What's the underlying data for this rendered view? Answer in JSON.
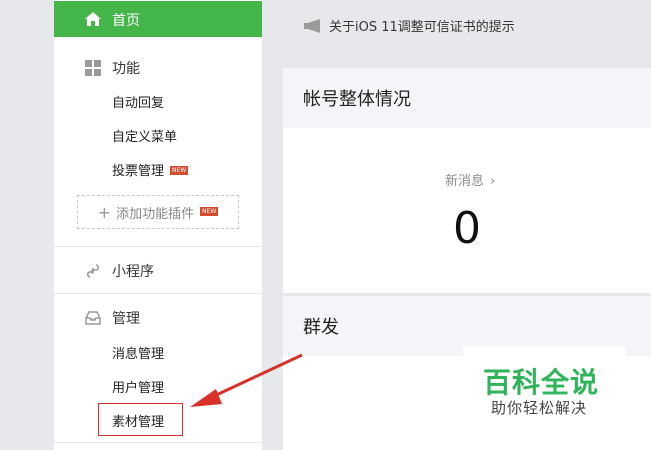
{
  "sidebar": {
    "home": {
      "label": "首页",
      "icon": "home-icon"
    },
    "features": {
      "label": "功能",
      "icon": "grid-icon",
      "items": [
        {
          "label": "自动回复"
        },
        {
          "label": "自定义菜单"
        },
        {
          "label": "投票管理",
          "badge": "NEW"
        }
      ],
      "add_plugin": {
        "label": "添加功能插件",
        "badge": "NEW"
      }
    },
    "mini_program": {
      "label": "小程序",
      "icon": "link-icon"
    },
    "manage": {
      "label": "管理",
      "icon": "inbox-icon",
      "items": [
        {
          "label": "消息管理"
        },
        {
          "label": "用户管理"
        },
        {
          "label": "素材管理"
        }
      ]
    }
  },
  "main": {
    "notice": {
      "text": "关于iOS 11调整可信证书的提示",
      "icon": "megaphone-icon"
    },
    "account_overview": {
      "title": "帐号整体情况",
      "stat_label": "新消息",
      "stat_value": "0"
    },
    "broadcast": {
      "title": "群发"
    }
  },
  "watermark": {
    "title": "百科全说",
    "subtitle": "助你轻松解决"
  },
  "colors": {
    "accent_green": "#44b549",
    "highlight_red": "#d8312a",
    "badge_red": "#d44d2f",
    "watermark_green": "#2fb45a"
  }
}
